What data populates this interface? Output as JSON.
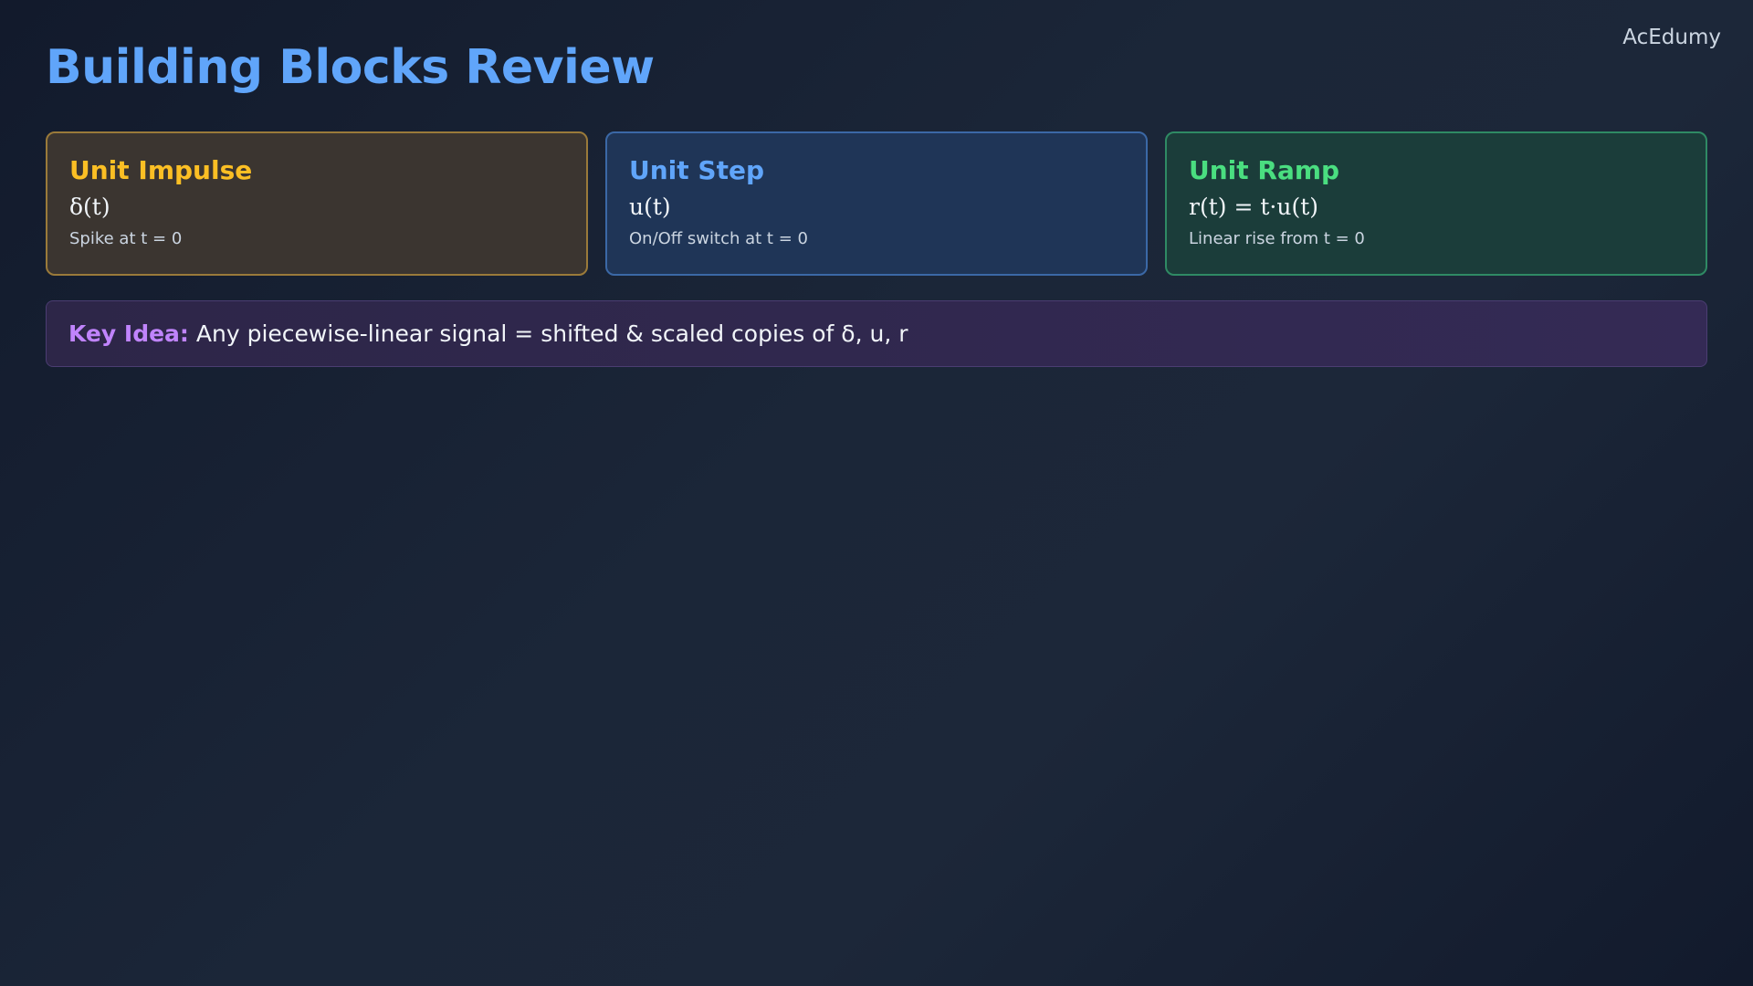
{
  "brand": "AcEdumy",
  "page_title": "Building Blocks Review",
  "cards": [
    {
      "title": "Unit Impulse",
      "formula": "δ(t)",
      "description": "Spike at t = 0",
      "color": "#fbbf24"
    },
    {
      "title": "Unit Step",
      "formula": "u(t)",
      "description": "On/Off switch at t = 0",
      "color": "#60a5fa"
    },
    {
      "title": "Unit Ramp",
      "formula": "r(t) = t·u(t)",
      "description": "Linear rise from t = 0",
      "color": "#4ade80"
    }
  ],
  "key_idea": {
    "label": "Key Idea:",
    "text": "Any piecewise-linear signal = shifted & scaled copies of δ, u, r",
    "label_color": "#c084fc"
  }
}
